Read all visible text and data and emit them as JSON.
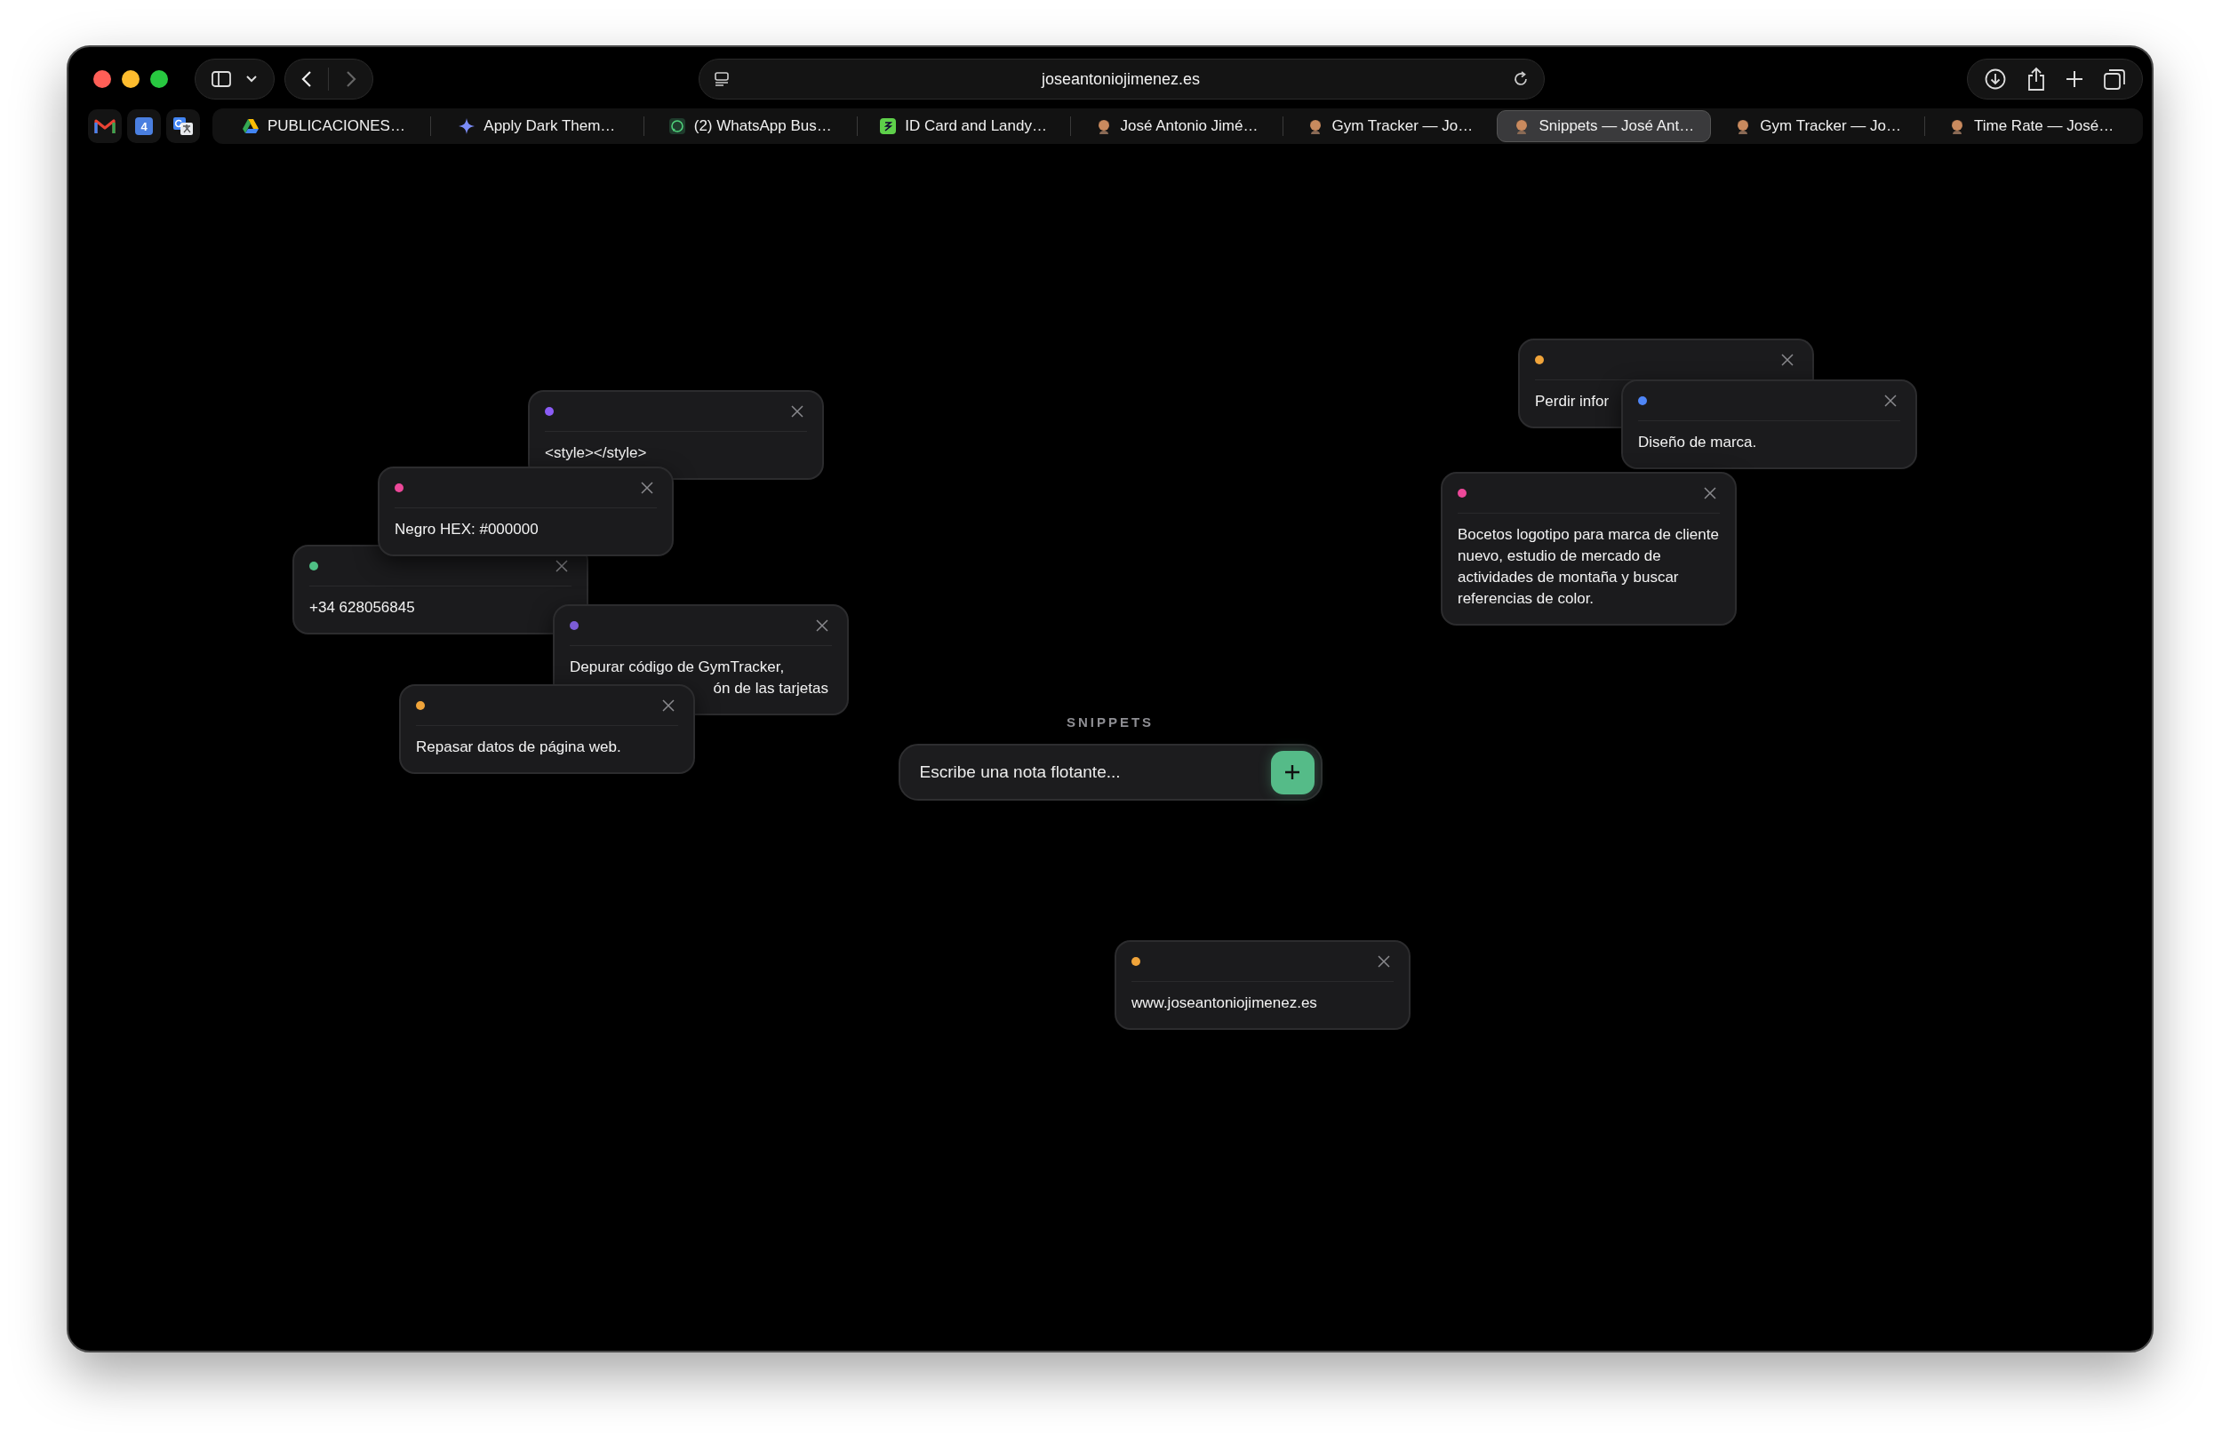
{
  "window": {
    "address": "joseantoniojimenez.es"
  },
  "pinned_tabs": [
    {
      "kind": "mail"
    },
    {
      "kind": "calendar",
      "label": "4"
    },
    {
      "kind": "translate"
    }
  ],
  "tabs": [
    {
      "label": "PUBLICACIONES…",
      "selected": false
    },
    {
      "label": "Apply Dark Them…",
      "selected": false
    },
    {
      "label": "(2) WhatsApp Bus…",
      "selected": false
    },
    {
      "label": "ID Card and Landy…",
      "selected": false
    },
    {
      "label": "José Antonio Jimé…",
      "selected": false
    },
    {
      "label": "Gym Tracker — Jo…",
      "selected": false
    },
    {
      "label": "Snippets — José Ant…",
      "selected": true
    },
    {
      "label": "Gym Tracker — Jo…",
      "selected": false
    },
    {
      "label": "Time Rate — José…",
      "selected": false
    }
  ],
  "app": {
    "title": "SNIPPETS",
    "input": {
      "placeholder": "Escribe una nota flotante..."
    }
  },
  "notes": [
    {
      "color": "#8b5cf6",
      "text": "<style></style>"
    },
    {
      "color": "#4fbf85",
      "text": "+34 628056845"
    },
    {
      "color": "#ec4899",
      "text": "Negro HEX: #000000"
    },
    {
      "color": "#7c5cd6",
      "text": "Depurar código de GymTracker,",
      "tail": "ón de las tarjetas"
    },
    {
      "color": "#f0a43a",
      "text": "Repasar datos de página web."
    },
    {
      "color": "#f0a43a",
      "text": "Perdir infor"
    },
    {
      "color": "#4f86f7",
      "text": "Diseño de marca."
    },
    {
      "color": "#ec4899",
      "text": "Bocetos logotipo para marca de cliente nuevo, estudio de mercado de actividades de montaña y buscar referencias de color."
    },
    {
      "color": "#f0a43a",
      "text": "www.joseantoniojimenez.es"
    }
  ]
}
